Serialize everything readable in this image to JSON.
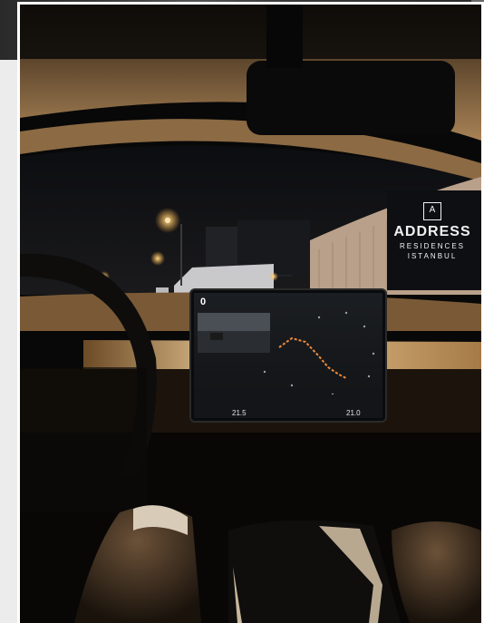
{
  "photo": {
    "sign": {
      "brand_line": "ADDRESS",
      "sub_line_1": "RESIDENCES",
      "sub_line_2": "ISTANBUL"
    },
    "screen": {
      "speed": "0",
      "temp_left": "21.5",
      "temp_right": "21.0"
    }
  }
}
